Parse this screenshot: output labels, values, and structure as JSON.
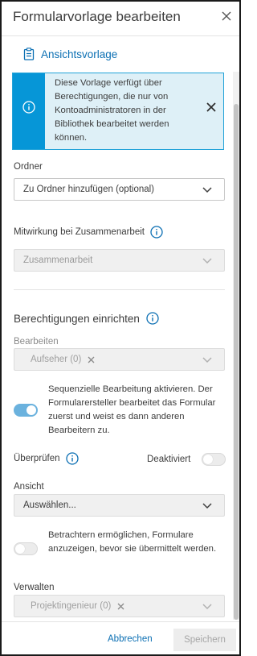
{
  "header": {
    "title": "Formularvorlage bearbeiten"
  },
  "subnav": {
    "link_label": "Ansichtsvorlage"
  },
  "info_banner": {
    "text": "Diese Vorlage verfügt über Berechtigungen, die nur von Kontoadministratoren in der Bibliothek bearbeitet werden können."
  },
  "folder": {
    "label": "Ordner",
    "value": "Zu Ordner hinzufügen (optional)"
  },
  "collaboration": {
    "label": "Mitwirkung bei Zusammenarbeit",
    "value": "Zusammenarbeit"
  },
  "permissions": {
    "title": "Berechtigungen einrichten",
    "edit": {
      "label": "Bearbeiten",
      "chip": "Aufseher (0)"
    },
    "sequential": {
      "enabled": true,
      "text": "Sequenzielle Bearbeitung aktivieren. Der Formularersteller bearbeitet das Formular zuerst und weist es dann anderen Bearbeitern zu."
    },
    "review": {
      "label": "Überprüfen",
      "status": "Deaktiviert",
      "enabled": false
    },
    "view": {
      "label": "Ansicht",
      "value": "Auswählen..."
    },
    "viewers_toggle": {
      "enabled": false,
      "text": "Betrachtern ermöglichen, Formulare anzuzeigen, bevor sie übermittelt werden."
    },
    "manage": {
      "label": "Verwalten",
      "chip": "Projektingenieur (0)"
    }
  },
  "footer": {
    "cancel_label": "Abbrechen",
    "save_label": "Speichern"
  },
  "colors": {
    "accent": "#0696d7",
    "link": "#0b6fb3",
    "banner_bg": "#def0f7",
    "toggle_on": "#6bb2de"
  }
}
